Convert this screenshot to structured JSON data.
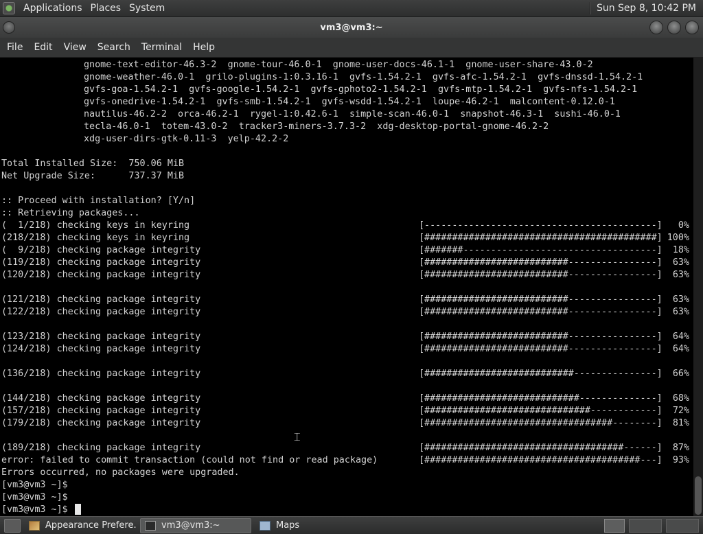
{
  "top_panel": {
    "menus": [
      "Applications",
      "Places",
      "System"
    ],
    "clock": "Sun Sep  8, 10:42 PM"
  },
  "window": {
    "title": "vm3@vm3:~"
  },
  "menubar": {
    "items": [
      "File",
      "Edit",
      "View",
      "Search",
      "Terminal",
      "Help"
    ]
  },
  "terminal": {
    "package_lines": [
      "gnome-text-editor-46.3-2  gnome-tour-46.0-1  gnome-user-docs-46.1-1  gnome-user-share-43.0-2",
      "gnome-weather-46.0-1  grilo-plugins-1:0.3.16-1  gvfs-1.54.2-1  gvfs-afc-1.54.2-1  gvfs-dnssd-1.54.2-1",
      "gvfs-goa-1.54.2-1  gvfs-google-1.54.2-1  gvfs-gphoto2-1.54.2-1  gvfs-mtp-1.54.2-1  gvfs-nfs-1.54.2-1",
      "gvfs-onedrive-1.54.2-1  gvfs-smb-1.54.2-1  gvfs-wsdd-1.54.2-1  loupe-46.2-1  malcontent-0.12.0-1",
      "nautilus-46.2-2  orca-46.2-1  rygel-1:0.42.6-1  simple-scan-46.0-1  snapshot-46.3-1  sushi-46.0-1",
      "tecla-46.0-1  totem-43.0-2  tracker3-miners-3.7.3-2  xdg-desktop-portal-gnome-46.2-2",
      "xdg-user-dirs-gtk-0.11-3  yelp-42.2-2"
    ],
    "total_installed": "Total Installed Size:  750.06 MiB",
    "net_upgrade": "Net Upgrade Size:      737.37 MiB",
    "proceed": ":: Proceed with installation? [Y/n]",
    "retrieving": ":: Retrieving packages...",
    "progress": [
      {
        "text": "(  1/218) checking keys in keyring",
        "bar": "[------------------------------------------]",
        "pct": "0%"
      },
      {
        "text": "(218/218) checking keys in keyring",
        "bar": "[##########################################]",
        "pct": "100%"
      },
      {
        "text": "(  9/218) checking package integrity",
        "bar": "[#######-----------------------------------]",
        "pct": "18%"
      },
      {
        "text": "(119/218) checking package integrity",
        "bar": "[##########################----------------]",
        "pct": "63%"
      },
      {
        "text": "(120/218) checking package integrity",
        "bar": "[##########################----------------]",
        "pct": "63%"
      },
      {
        "text": "",
        "bar": "",
        "pct": ""
      },
      {
        "text": "(121/218) checking package integrity",
        "bar": "[##########################----------------]",
        "pct": "63%"
      },
      {
        "text": "(122/218) checking package integrity",
        "bar": "[##########################----------------]",
        "pct": "63%"
      },
      {
        "text": "",
        "bar": "",
        "pct": ""
      },
      {
        "text": "(123/218) checking package integrity",
        "bar": "[##########################----------------]",
        "pct": "64%"
      },
      {
        "text": "(124/218) checking package integrity",
        "bar": "[##########################----------------]",
        "pct": "64%"
      },
      {
        "text": "",
        "bar": "",
        "pct": ""
      },
      {
        "text": "(136/218) checking package integrity",
        "bar": "[###########################---------------]",
        "pct": "66%"
      },
      {
        "text": "",
        "bar": "",
        "pct": ""
      },
      {
        "text": "(144/218) checking package integrity",
        "bar": "[############################--------------]",
        "pct": "68%"
      },
      {
        "text": "(157/218) checking package integrity",
        "bar": "[##############################------------]",
        "pct": "72%"
      },
      {
        "text": "(179/218) checking package integrity",
        "bar": "[##################################--------]",
        "pct": "81%"
      },
      {
        "text": "",
        "bar": "",
        "pct": ""
      },
      {
        "text": "(189/218) checking package integrity",
        "bar": "[####################################------]",
        "pct": "87%"
      },
      {
        "text": "error: failed to commit transaction (could not find or read package)",
        "bar": "[#######################################---]",
        "pct": "93%"
      }
    ],
    "errors_line": "Errors occurred, no packages were upgraded.",
    "prompts": [
      "[vm3@vm3 ~]$",
      "[vm3@vm3 ~]$",
      "[vm3@vm3 ~]$ "
    ]
  },
  "taskbar": {
    "tasks": [
      {
        "label": "Appearance Prefere...",
        "icon": "appearance-icon",
        "active": false
      },
      {
        "label": "vm3@vm3:~",
        "icon": "terminal-icon",
        "active": true
      },
      {
        "label": "Maps",
        "icon": "maps-icon",
        "active": false
      }
    ]
  }
}
